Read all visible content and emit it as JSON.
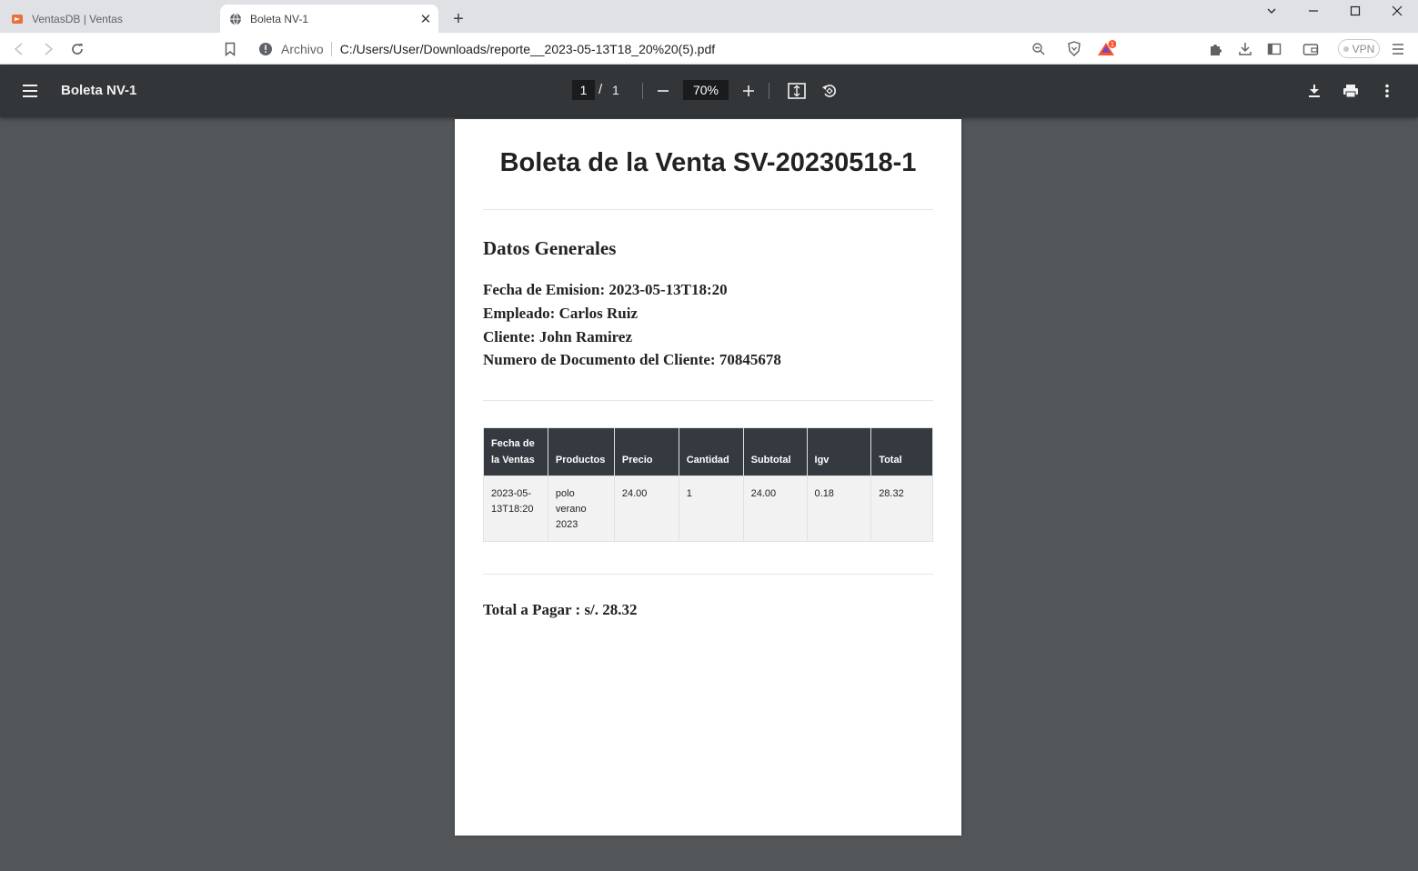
{
  "browser": {
    "tabs": [
      {
        "title": "VentasDB | Ventas",
        "active": false
      },
      {
        "title": "Boleta NV-1",
        "active": true
      }
    ],
    "address": {
      "scheme_label": "Archivo",
      "url": "C:/Users/User/Downloads/reporte__2023-05-13T18_20%20(5).pdf"
    },
    "brave_badge_count": "1",
    "vpn_label": "VPN"
  },
  "pdf_viewer": {
    "doc_title": "Boleta NV-1",
    "current_page": "1",
    "page_separator": "/",
    "total_pages": "1",
    "zoom": "70%"
  },
  "document": {
    "title": "Boleta de la Venta SV-20230518-1",
    "section_heading": "Datos Generales",
    "fields": [
      "Fecha de Emision: 2023-05-13T18:20",
      "Empleado: Carlos Ruiz",
      "Cliente: John Ramirez",
      "Numero de Documento del Cliente: 70845678"
    ],
    "table": {
      "headers": [
        "Fecha de la Ventas",
        "Productos",
        "Precio",
        "Cantidad",
        "Subtotal",
        "Igv",
        "Total"
      ],
      "rows": [
        [
          "2023-05-13T18:20",
          "polo verano 2023",
          "24.00",
          "1",
          "24.00",
          "0.18",
          "28.32"
        ]
      ]
    },
    "total_line": "Total a Pagar : s/. 28.32"
  },
  "colors": {
    "viewer_background": "#525659",
    "viewer_toolbar": "#323639",
    "table_header": "#343a40",
    "brave_accent": "#fb542b"
  }
}
